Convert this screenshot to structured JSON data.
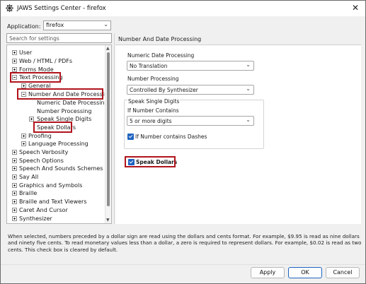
{
  "window": {
    "title": "JAWS Settings Center - firefox",
    "close_glyph": "✕"
  },
  "application": {
    "label": "Application:",
    "value": "firefox"
  },
  "search": {
    "placeholder": "Search for settings"
  },
  "tree": {
    "items": [
      {
        "label": "User",
        "expander": "plus"
      },
      {
        "label": "Web / HTML / PDFs",
        "expander": "plus"
      },
      {
        "label": "Forms Mode",
        "expander": "plus"
      },
      {
        "label": "Text Processing",
        "expander": "minus"
      },
      {
        "label": "General",
        "expander": "plus"
      },
      {
        "label": "Number And Date Processing",
        "expander": "minus"
      },
      {
        "label": "Numeric Date Processing",
        "expander": "none"
      },
      {
        "label": "Number Processing",
        "expander": "none"
      },
      {
        "label": "Speak Single Digits",
        "expander": "plus"
      },
      {
        "label": "Speak Dollars",
        "expander": "none"
      },
      {
        "label": "Proofing",
        "expander": "plus"
      },
      {
        "label": "Language Processing",
        "expander": "plus"
      },
      {
        "label": "Speech Verbosity",
        "expander": "plus"
      },
      {
        "label": "Speech Options",
        "expander": "plus"
      },
      {
        "label": "Speech And Sounds Schemes",
        "expander": "plus"
      },
      {
        "label": "Say All",
        "expander": "plus"
      },
      {
        "label": "Graphics and Symbols",
        "expander": "plus"
      },
      {
        "label": "Braille",
        "expander": "plus"
      },
      {
        "label": "Braille and Text Viewers",
        "expander": "plus"
      },
      {
        "label": "Caret And Cursor",
        "expander": "plus"
      },
      {
        "label": "Synthesizer",
        "expander": "plus"
      }
    ]
  },
  "panel": {
    "title": "Number And Date Processing",
    "numeric_date_label": "Numeric Date Processing",
    "numeric_date_value": "No Translation",
    "number_processing_label": "Number Processing",
    "number_processing_value": "Controlled By Synthesizer",
    "single_digits_group": "Speak Single Digits",
    "if_number_contains_label": "If Number Contains",
    "if_number_contains_value": "5 or more digits",
    "dashes_label": "If Number contains Dashes",
    "dashes_checked": true,
    "speak_dollars_label": "Speak Dollars",
    "speak_dollars_checked": true
  },
  "description": "When selected, numbers preceded by a dollar sign are read using the dollars and cents format. For example, $9.95 is read as nine dollars and ninety five cents. To read monetary values less than a dollar, a zero is required to represent dollars. For example, $0.02 is read as two cents. This check box is cleared by default.",
  "buttons": {
    "apply": "Apply",
    "ok": "OK",
    "cancel": "Cancel"
  },
  "colors": {
    "highlight": "#b0141c",
    "accent": "#1f63c0"
  }
}
